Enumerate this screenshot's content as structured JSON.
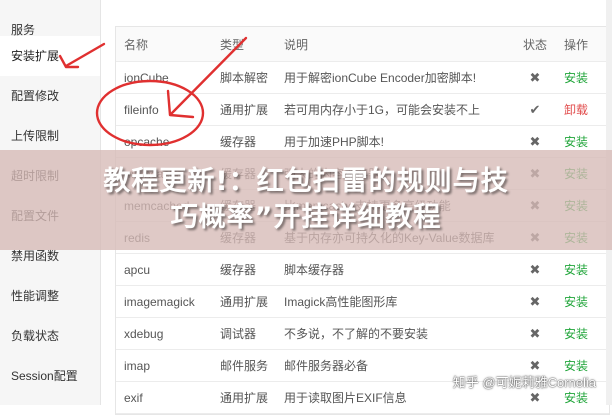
{
  "sidebar": {
    "items": [
      {
        "label": "服务"
      },
      {
        "label": "安装扩展",
        "active": true
      },
      {
        "label": "配置修改"
      },
      {
        "label": "上传限制"
      },
      {
        "label": "超时限制"
      },
      {
        "label": "配置文件"
      },
      {
        "label": "禁用函数"
      },
      {
        "label": "性能调整"
      },
      {
        "label": "负载状态"
      },
      {
        "label": "Session配置"
      }
    ]
  },
  "table": {
    "headers": {
      "name": "名称",
      "type": "类型",
      "desc": "说明",
      "status": "状态",
      "op": "操作"
    },
    "rows": [
      {
        "name": "ionCube",
        "type": "脚本解密",
        "desc": "用于解密ionCube Encoder加密脚本!",
        "status": "✖",
        "op": "安装"
      },
      {
        "name": "fileinfo",
        "type": "通用扩展",
        "desc": "若可用内存小于1G，可能会安装不上",
        "status": "✔",
        "op": "卸载"
      },
      {
        "name": "opcache",
        "type": "缓存器",
        "desc": "用于加速PHP脚本!",
        "status": "✖",
        "op": "安装"
      },
      {
        "name": "memcache",
        "type": "缓存器",
        "desc": "强大的内容缓存器",
        "status": "✖",
        "op": "安装"
      },
      {
        "name": "memcached",
        "type": "缓存器",
        "desc": "比memcache支持更多高级功能",
        "status": "✖",
        "op": "安装"
      },
      {
        "name": "redis",
        "type": "缓存器",
        "desc": "基于内存亦可持久化的Key-Value数据库",
        "status": "✖",
        "op": "安装"
      },
      {
        "name": "apcu",
        "type": "缓存器",
        "desc": "脚本缓存器",
        "status": "✖",
        "op": "安装"
      },
      {
        "name": "imagemagick",
        "type": "通用扩展",
        "desc": "Imagick高性能图形库",
        "status": "✖",
        "op": "安装"
      },
      {
        "name": "xdebug",
        "type": "调试器",
        "desc": "不多说，不了解的不要安装",
        "status": "✖",
        "op": "安装"
      },
      {
        "name": "imap",
        "type": "邮件服务",
        "desc": "邮件服务器必备",
        "status": "✖",
        "op": "安装"
      },
      {
        "name": "exif",
        "type": "通用扩展",
        "desc": "用于读取图片EXIF信息",
        "status": "✖",
        "op": "安装"
      }
    ]
  },
  "banner": {
    "title_line1": "教程更新!：红包扫雷的规则与技",
    "title_line2": "巧概率”开挂详细教程"
  },
  "watermark": "知乎 @可妮莉雅Cornelia",
  "colors": {
    "install": "#20a53a",
    "uninstall": "#e14b4b",
    "arrow": "#e03030"
  }
}
